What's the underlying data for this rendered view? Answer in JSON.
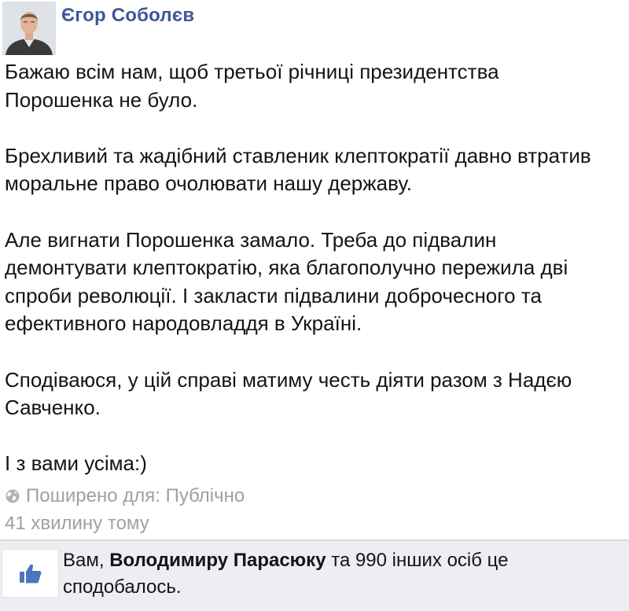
{
  "post": {
    "author": "Єгор Соболєв",
    "paragraphs": [
      [
        "Бажаю всім нам, щоб третьої річниці президентства",
        "Порошенка не було."
      ],
      [
        "Брехливий та жадібний ставленик клептократії давно втратив",
        "моральне право очолювати нашу державу."
      ],
      [
        "Але вигнати Порошенка замало. Треба до підвалин",
        "демонтувати клептократію, яка благополучно пережила дві",
        "спроби революції. І закласти підвалини доброчесного та",
        "ефективного народовладдя в Україні."
      ],
      [
        "Сподіваюся, у цій справі матиму честь діяти разом з Надєю",
        "Савченко."
      ],
      [
        "І з вами усіма:)"
      ]
    ],
    "privacy": "Поширено для: Публічно",
    "time": "41 хвилину тому"
  },
  "likes": {
    "prefix": "Вам, ",
    "highlight": "Володимиру Парасюку",
    "suffix": " та 990 інших осіб це",
    "line2": "сподобалось."
  },
  "icons": {
    "avatar": "author-avatar",
    "privacy": "globe-icon",
    "like": "thumbs-up-icon"
  },
  "colors": {
    "author": "#3b5998",
    "meta": "#a0a0a0",
    "likes_bg": "#eceef1",
    "like_icon": "#4b76be"
  }
}
